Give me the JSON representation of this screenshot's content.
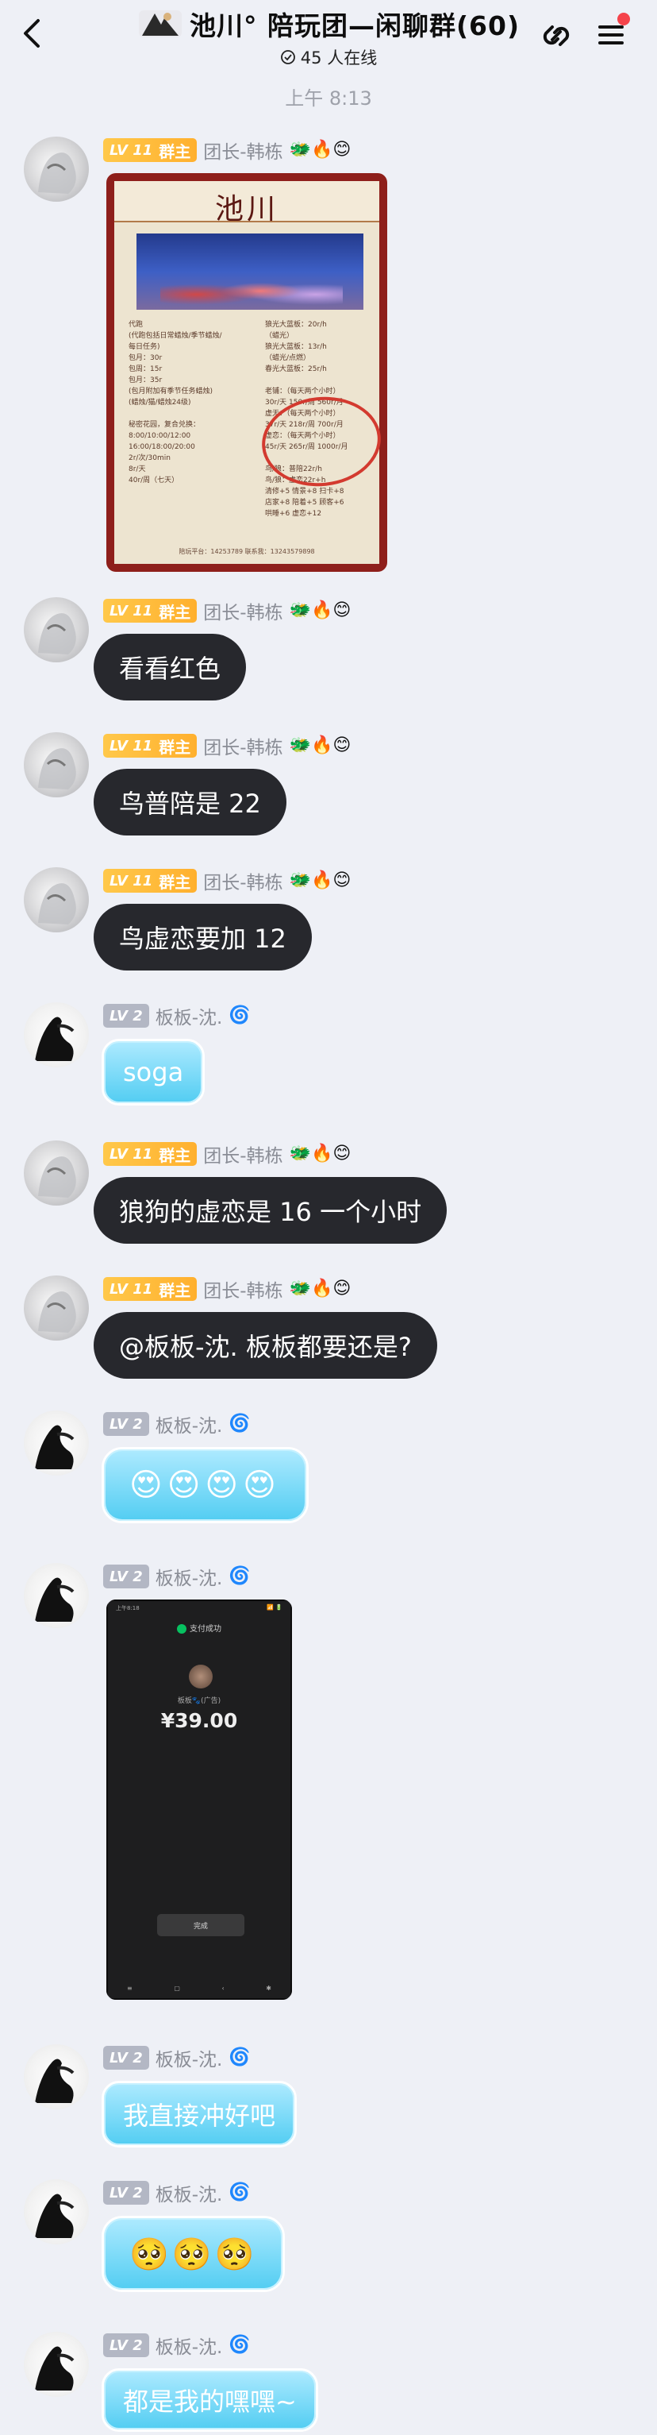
{
  "header": {
    "title": "池川°  陪玩团—闲聊群(60)",
    "online": "45 人在线"
  },
  "timestamp": "上午 8:13",
  "users": {
    "owner": {
      "level": "LV 11",
      "role": "群主",
      "nick": "团长-韩栋",
      "tags": "🐲🔥😊"
    },
    "member": {
      "level": "LV 2",
      "nick": "板板-沈.",
      "tags": "🌀"
    }
  },
  "messages": [
    {
      "type": "image",
      "sender": "owner",
      "image": "price-list"
    },
    {
      "type": "text",
      "sender": "owner",
      "text": "看看红色"
    },
    {
      "type": "text",
      "sender": "owner",
      "text": "鸟普陪是 22"
    },
    {
      "type": "text",
      "sender": "owner",
      "text": "鸟虚恋要加 12"
    },
    {
      "type": "text",
      "sender": "member",
      "text": "soga"
    },
    {
      "type": "text",
      "sender": "owner",
      "text": "狼狗的虚恋是 16 一个小时"
    },
    {
      "type": "text",
      "sender": "owner",
      "text": "@板板-沈. 板板都要还是?"
    },
    {
      "type": "text",
      "sender": "member",
      "text": "😍😍😍😍"
    },
    {
      "type": "image",
      "sender": "member",
      "image": "payment"
    },
    {
      "type": "text",
      "sender": "member",
      "text": "我直接冲好吧"
    },
    {
      "type": "text",
      "sender": "member",
      "text": "🥺🥺🥺"
    },
    {
      "type": "text",
      "sender": "member",
      "text": "都是我的嘿嘿~"
    }
  ],
  "price_card": {
    "title": "池川",
    "left_text": "代跑\n(代跑包括日常蜡烛/季节蜡烛/\n每日任务)\n包月：30r\n包周：15r\n包月：35r\n(包月附加有季节任务蜡烛)\n(蜡烛/猫/蜡烛24级)\n\n秘密花园，复合兑换：\n8:00/10:00/12:00\n16:00/18:00/20:00\n2r/次/30min\n8r/天\n40r/周（七天）",
    "right_text": "狼光大蓝板：20r/h\n（蜡光）\n狼光大蓝板：13r/h\n（蜡光/点燃）\n春光大蓝板：25r/h\n\n老铺：（每天两个小时）\n30r/天 150r/周 560r/月\n虚无：（每天两个小时）\n37r/天 218r/周 700r/月\n虚恋：（每天两个小时）\n45r/天 265r/周 1000r/月\n\n鸟/狼：普陪22r/h\n鸟/狼：虚恋22r+h\n清修+5 情景+8 扫卡+8\n店家+8 陪着+5 顾客+6\n哄睡+6 虚恋+12",
    "footer": "陪玩平台：14253789  联系我：13243579898"
  },
  "payment": {
    "status_left": "上午8:18",
    "status_right": "📶 🔋",
    "success": "支付成功",
    "payee": "板板🐾(广告)",
    "amount": "¥39.00",
    "done": "完成",
    "nav": [
      "≡",
      "▢",
      "‹",
      "✱"
    ]
  },
  "colors": {
    "background": "#eef0f6",
    "owner_bubble": "#27282d",
    "member_bubble": "#52cdf2",
    "owner_badge": "#ffb02e",
    "member_badge": "#b3b7c4",
    "notification_dot": "#f5434b"
  },
  "icons": {
    "back": "chevron-left-icon",
    "link": "link-icon",
    "menu": "hamburger-menu-icon",
    "online": "online-status-icon"
  }
}
